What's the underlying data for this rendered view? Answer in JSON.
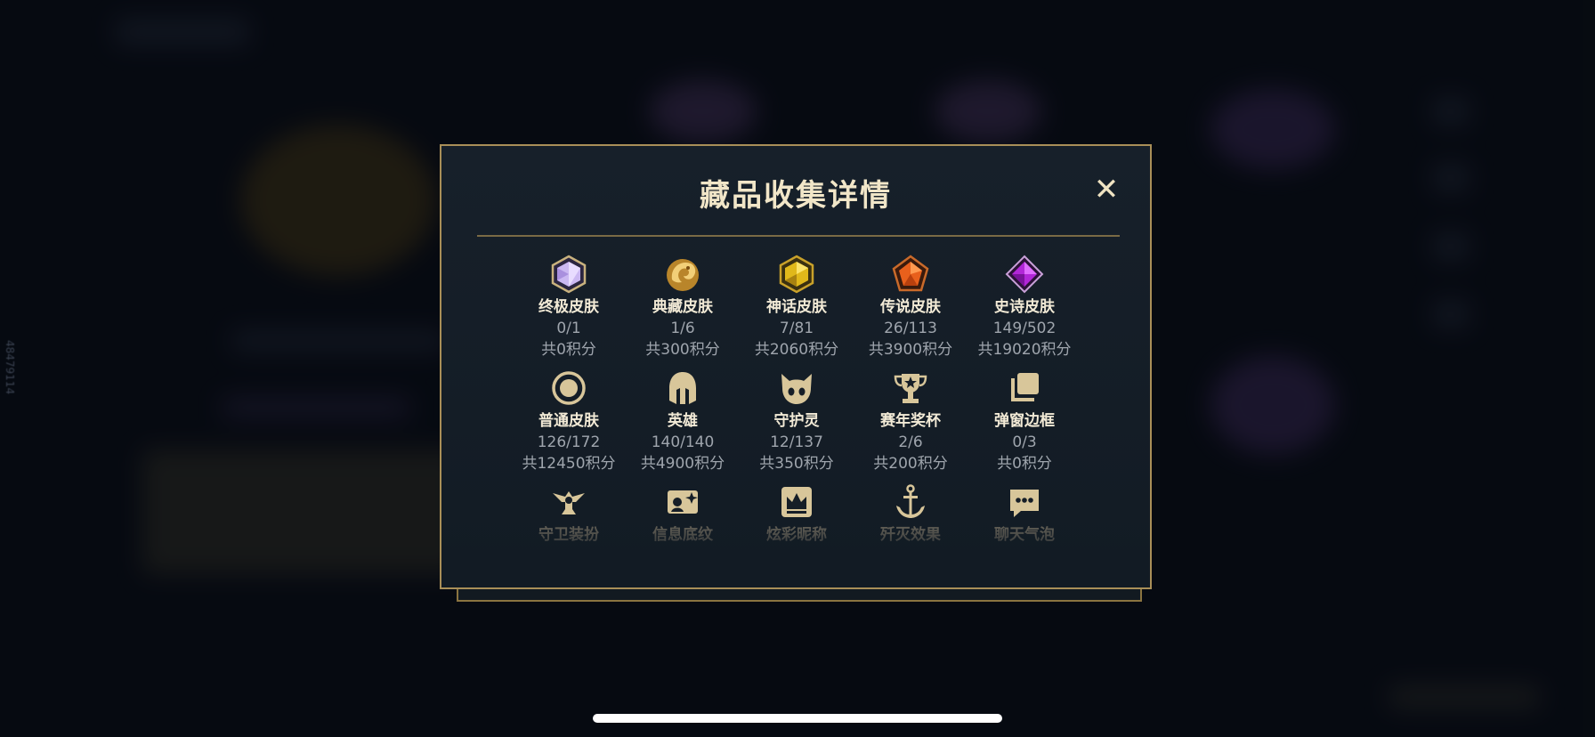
{
  "dialog": {
    "title": "藏品收集详情",
    "close_icon": "✕"
  },
  "side_id": "48479114",
  "items": [
    {
      "name": "终极皮肤",
      "count": "0/1",
      "points": "共0积分",
      "icon": "ultimate-gem-icon"
    },
    {
      "name": "典藏皮肤",
      "count": "1/6",
      "points": "共300积分",
      "icon": "dragon-emblem-icon"
    },
    {
      "name": "神话皮肤",
      "count": "7/81",
      "points": "共2060积分",
      "icon": "mythic-gem-icon"
    },
    {
      "name": "传说皮肤",
      "count": "26/113",
      "points": "共3900积分",
      "icon": "legendary-gem-icon"
    },
    {
      "name": "史诗皮肤",
      "count": "149/502",
      "points": "共19020积分",
      "icon": "epic-gem-icon"
    },
    {
      "name": "普通皮肤",
      "count": "126/172",
      "points": "共12450积分",
      "icon": "circle-icon"
    },
    {
      "name": "英雄",
      "count": "140/140",
      "points": "共4900积分",
      "icon": "helmet-icon"
    },
    {
      "name": "守护灵",
      "count": "12/137",
      "points": "共350积分",
      "icon": "pet-icon"
    },
    {
      "name": "赛年奖杯",
      "count": "2/6",
      "points": "共200积分",
      "icon": "trophy-icon"
    },
    {
      "name": "弹窗边框",
      "count": "0/3",
      "points": "共0积分",
      "icon": "frame-icon"
    },
    {
      "name": "守卫装扮",
      "count": "",
      "points": "",
      "icon": "ward-icon"
    },
    {
      "name": "信息底纹",
      "count": "",
      "points": "",
      "icon": "card-icon"
    },
    {
      "name": "炫彩昵称",
      "count": "",
      "points": "",
      "icon": "crown-badge-icon"
    },
    {
      "name": "歼灭效果",
      "count": "",
      "points": "",
      "icon": "anchor-icon"
    },
    {
      "name": "聊天气泡",
      "count": "",
      "points": "",
      "icon": "chat-bubble-icon"
    }
  ],
  "colors": {
    "gold_border": "#a98f58",
    "title_text": "#f1e6c8",
    "label_text": "#f2ead6",
    "muted_text": "#9fa5ad",
    "icon_gold": "#d8c69a"
  }
}
